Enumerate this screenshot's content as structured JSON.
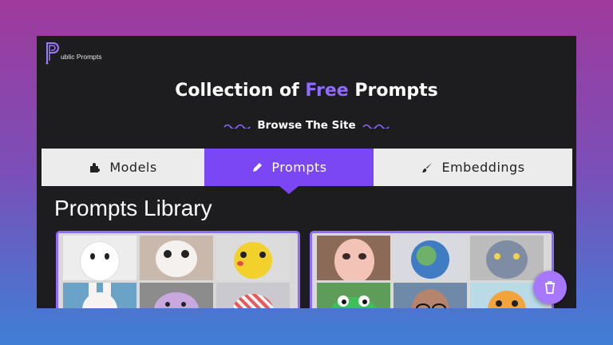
{
  "logo": {
    "text": "ublic Prompts"
  },
  "hero": {
    "title_part1": "Collection of",
    "title_accent": "Free",
    "title_part2": "Prompts"
  },
  "browse": {
    "label": "Browse The Site"
  },
  "tabs": [
    {
      "label": "Models",
      "icon": "puzzle-icon",
      "active": false
    },
    {
      "label": "Prompts",
      "icon": "pencil-icon",
      "active": true
    },
    {
      "label": "Embeddings",
      "icon": "brush-icon",
      "active": false
    }
  ],
  "library": {
    "title": "Prompts Library"
  },
  "colors": {
    "accent": "#7b47f5",
    "accent_light": "#8f6bff",
    "background": "#1d1d1f",
    "tab_bg": "#ececec"
  },
  "fab": {
    "icon": "cup-icon"
  },
  "cards": [
    {
      "thumbs": [
        "white-cat-plush",
        "panda-plush",
        "pikachu-plush",
        "white-bunny-plush",
        "purple-cat-plush",
        "red-pattern-plush"
      ]
    },
    {
      "thumbs": [
        "animated-girl-face",
        "earth-globe",
        "gray-creature",
        "green-frog-face",
        "man-with-glasses",
        "orange-toy-figure"
      ]
    }
  ]
}
